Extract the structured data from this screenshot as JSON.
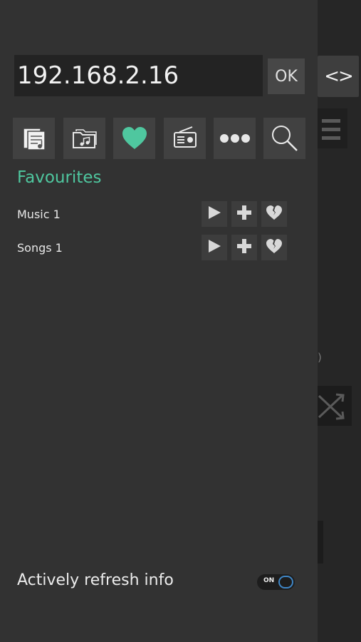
{
  "server": {
    "ip_value": "192.168.2.16",
    "ok_label": "OK",
    "toggle_label": "<>"
  },
  "toolbar": {
    "items": [
      {
        "icon": "playlist-icon"
      },
      {
        "icon": "music-folder-icon"
      },
      {
        "icon": "heart-icon",
        "active": true,
        "accent": "#4fc79f"
      },
      {
        "icon": "radio-icon"
      },
      {
        "icon": "more-icon"
      },
      {
        "icon": "search-icon"
      }
    ]
  },
  "favourites": {
    "title": "Favourites",
    "items": [
      {
        "label": "Music 1"
      },
      {
        "label": "Songs 1"
      }
    ]
  },
  "settings": {
    "refresh_label": "Actively refresh info",
    "refresh_toggle_text": "ON",
    "refresh_on": true
  },
  "colors": {
    "accent": "#4fc79f",
    "toggle_ring": "#3f86c6"
  },
  "background": {
    "fragment_text": ")"
  }
}
